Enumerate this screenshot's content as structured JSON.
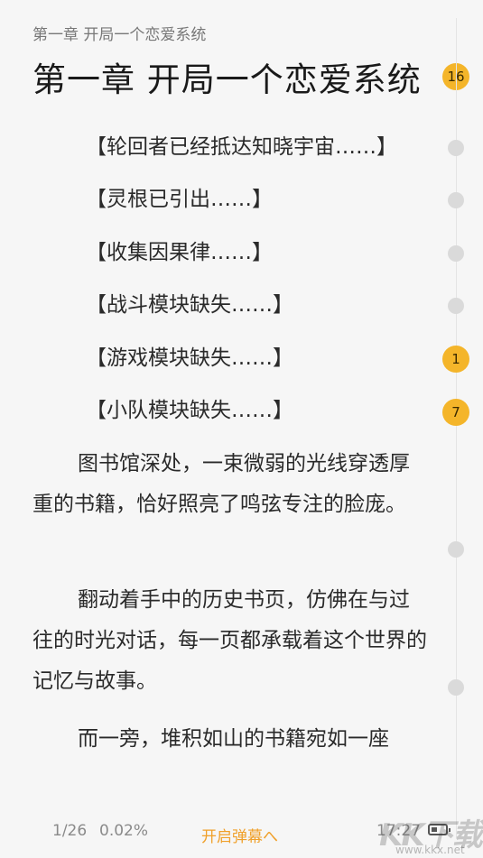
{
  "header": {
    "chapter_label": "第一章 开局一个恋爱系统",
    "chapter_title": "第一章 开局一个恋爱系统",
    "title_comment_count": "16"
  },
  "content": {
    "system_lines": [
      {
        "text": "【轮回者已经抵达知晓宇宙……】"
      },
      {
        "text": "【灵根已引出……】"
      },
      {
        "text": "【收集因果律……】"
      },
      {
        "text": "【战斗模块缺失……】"
      },
      {
        "text": "【游戏模块缺失……】",
        "comment_count": "1"
      },
      {
        "text": "【小队模块缺失……】",
        "comment_count": "7"
      }
    ],
    "paragraphs": [
      {
        "text": "图书馆深处，一束微弱的光线穿透厚重的书籍，恰好照亮了鸣弦专注的脸庞。"
      },
      {
        "text": "翻动着手中的历史书页，仿佛在与过往的时光对话，每一页都承载着这个世界的记忆与故事。"
      },
      {
        "text": "而一旁，堆积如山的书籍宛如一座"
      }
    ]
  },
  "footer": {
    "page_progress": "1/26",
    "percent": "0.02%",
    "danmaku_button": "开启弹幕へ",
    "time": "17:27",
    "battery_level": 0.4
  },
  "watermark": {
    "logo": "KK下载",
    "url": "www.kkx.net"
  },
  "colors": {
    "background": "#f6f6f6",
    "badge": "#f4b52a",
    "accent": "#f0a02a",
    "comment_dot": "#dadada"
  }
}
